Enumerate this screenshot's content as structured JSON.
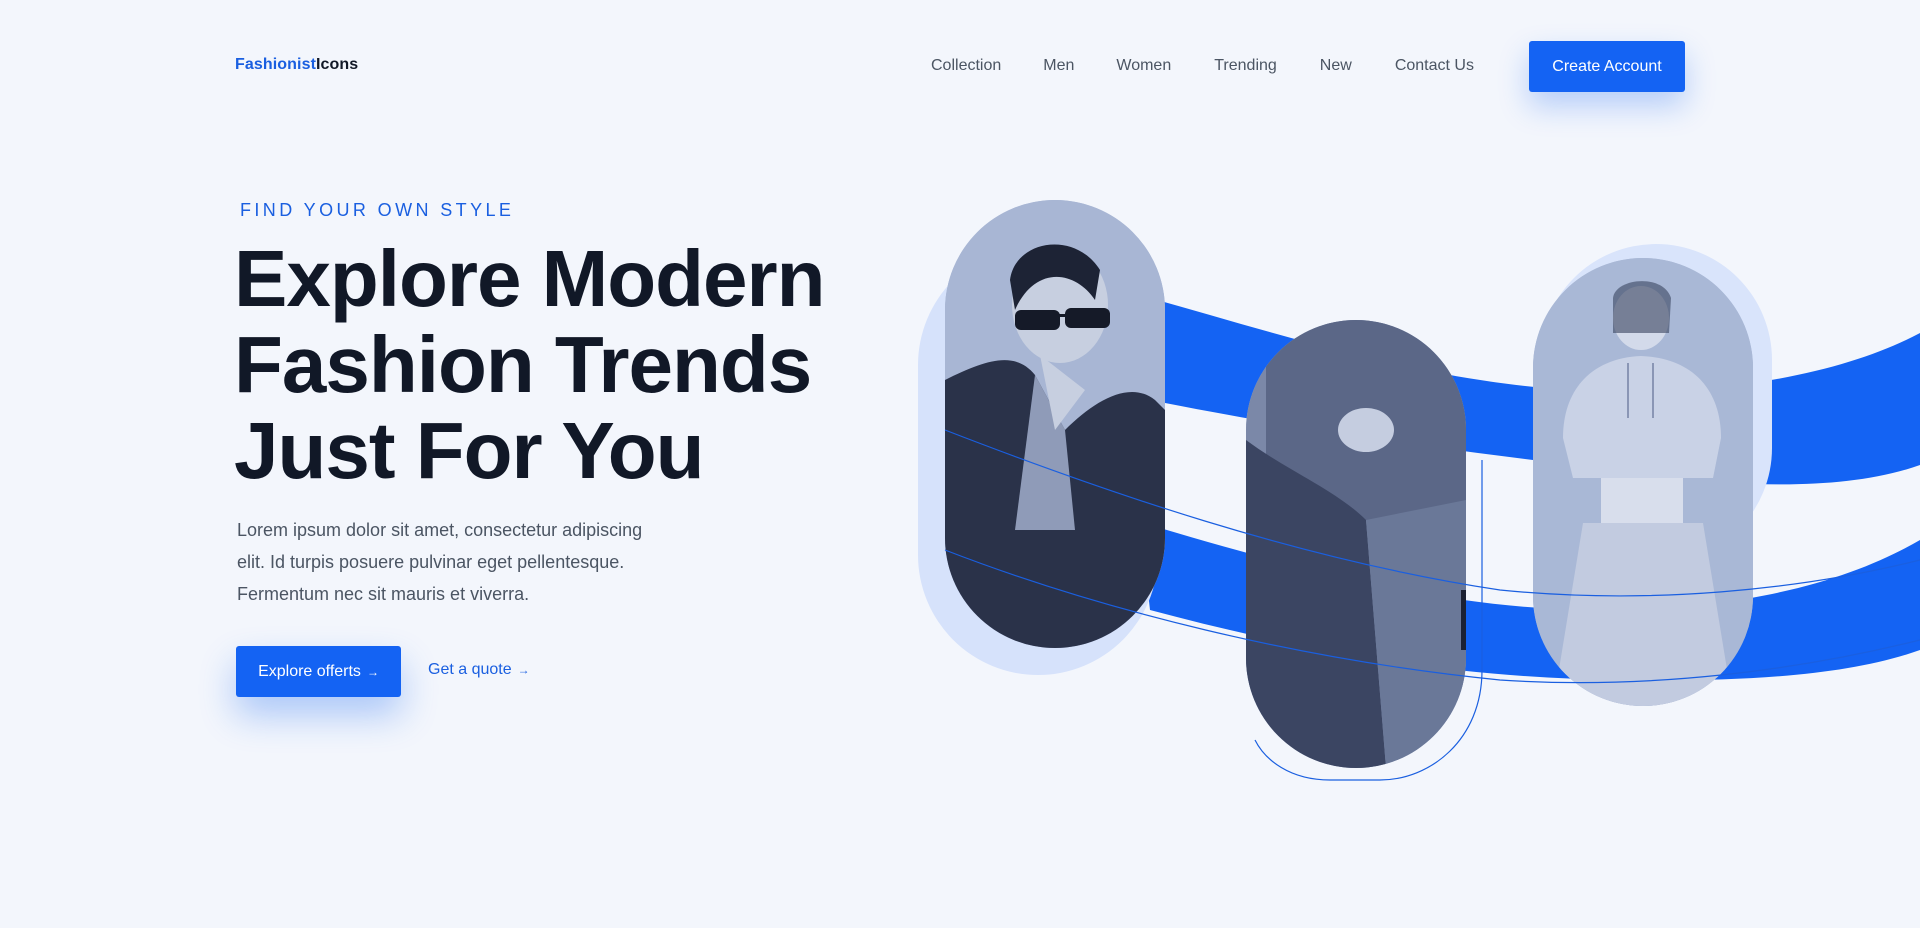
{
  "brand": {
    "part1": "Fashionist",
    "part2": "Icons"
  },
  "nav": {
    "items": [
      "Collection",
      "Men",
      "Women",
      "Trending",
      "New",
      "Contact Us"
    ],
    "cta": "Create Account"
  },
  "hero": {
    "eyebrow": "FIND YOUR OWN STYLE",
    "headline": [
      "Explore Modern",
      "Fashion Trends",
      "Just For You"
    ],
    "body": [
      "Lorem ipsum dolor sit amet, consectetur adipiscing",
      "elit. Id turpis posuere pulvinar eget pellentesque.",
      "Fermentum nec sit mauris et viverra."
    ],
    "primary_button": "Explore offerts",
    "secondary_link": "Get a quote"
  },
  "images": [
    {
      "name": "woman-sunglasses-coat"
    },
    {
      "name": "person-holding-coat"
    },
    {
      "name": "woman-hoodie-sweatpants"
    }
  ],
  "colors": {
    "accent": "#1463f3",
    "background": "#f3f6fc",
    "text": "#111827",
    "muted": "#4b5563"
  },
  "icons": {
    "arrow": "arrow-right-icon"
  }
}
